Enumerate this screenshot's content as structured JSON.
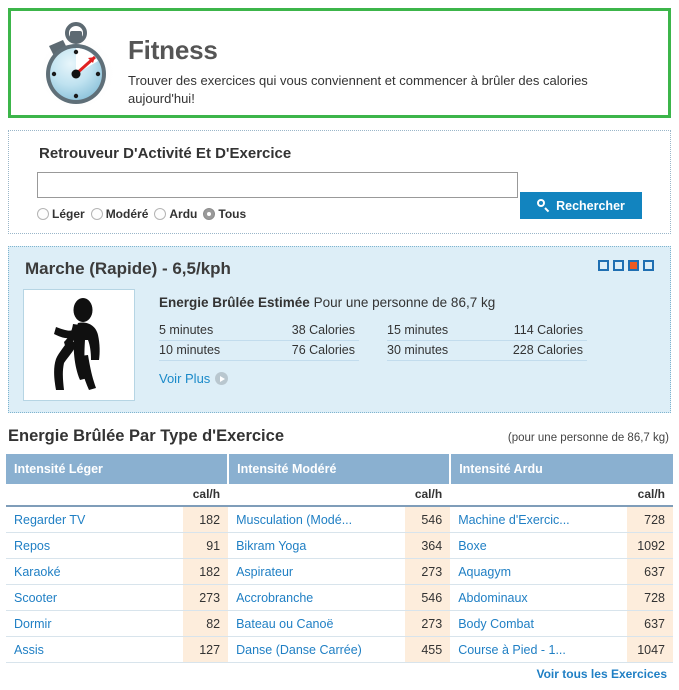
{
  "hero": {
    "icon": "stopwatch-icon",
    "title": "Fitness",
    "subtitle": "Trouver des exercices qui vous conviennent et commencer à brûler des calories aujourd'hui!",
    "border_color": "#3cb54a"
  },
  "search": {
    "title": "Retrouveur D'Activité Et D'Exercice",
    "input_value": "",
    "input_placeholder": "",
    "radios": [
      {
        "label": "Léger",
        "checked": false
      },
      {
        "label": "Modéré",
        "checked": false
      },
      {
        "label": "Ardu",
        "checked": false
      },
      {
        "label": "Tous",
        "checked": true
      }
    ],
    "button_label": "Rechercher",
    "button_icon": "search-icon",
    "button_color": "#1284bf"
  },
  "result_card": {
    "title": "Marche (Rapide) - 6,5/kph",
    "thumb_icon": "walking-person-icon",
    "pager": {
      "total": 4,
      "active_index": 2,
      "active_color": "#ef5a1f",
      "border_color": "#1f6fb2"
    },
    "estimate_label": "Energie Brûlée Estimée",
    "estimate_suffix": " Pour une personne de 86,7 kg",
    "calories": [
      {
        "duration": "5 minutes",
        "value": "38 Calories"
      },
      {
        "duration": "10 minutes",
        "value": "76 Calories"
      },
      {
        "duration": "15 minutes",
        "value": "114 Calories"
      },
      {
        "duration": "30 minutes",
        "value": "228 Calories"
      }
    ],
    "more_link": "Voir Plus",
    "more_icon": "play-circle-icon"
  },
  "table_section": {
    "title": "Energie Brûlée Par Type d'Exercice",
    "note": "(pour une personne de 86,7 kg)",
    "unit_header": "cal/h",
    "see_all_link": "Voir tous les Exercices",
    "columns": [
      {
        "header": "Intensité Léger"
      },
      {
        "header": "Intensité Modéré"
      },
      {
        "header": "Intensité Ardu"
      }
    ],
    "rows": [
      {
        "leger_name": "Regarder TV",
        "leger_val": "182",
        "modere_name": "Musculation (Modé...",
        "modere_val": "546",
        "ardu_name": "Machine d'Exercic...",
        "ardu_val": "728"
      },
      {
        "leger_name": "Repos",
        "leger_val": "91",
        "modere_name": "Bikram Yoga",
        "modere_val": "364",
        "ardu_name": "Boxe",
        "ardu_val": "1092"
      },
      {
        "leger_name": "Karaoké",
        "leger_val": "182",
        "modere_name": "Aspirateur",
        "modere_val": "273",
        "ardu_name": "Aquagym",
        "ardu_val": "637"
      },
      {
        "leger_name": "Scooter",
        "leger_val": "273",
        "modere_name": "Accrobranche",
        "modere_val": "546",
        "ardu_name": "Abdominaux",
        "ardu_val": "728"
      },
      {
        "leger_name": "Dormir",
        "leger_val": "82",
        "modere_name": "Bateau ou Canoë",
        "modere_val": "273",
        "ardu_name": "Body Combat",
        "ardu_val": "637"
      },
      {
        "leger_name": "Assis",
        "leger_val": "127",
        "modere_name": "Danse (Danse Carrée)",
        "modere_val": "455",
        "ardu_name": "Course à Pied - 1...",
        "ardu_val": "1047"
      }
    ]
  }
}
